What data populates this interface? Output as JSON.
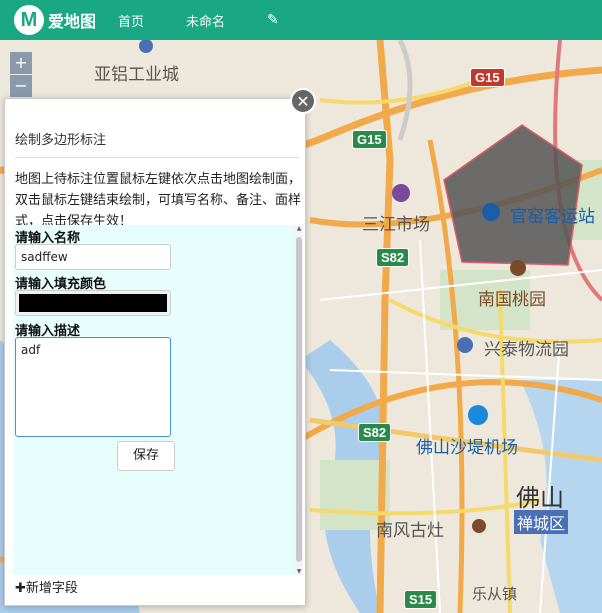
{
  "header": {
    "logo_letter": "M",
    "logo_text": "爱地图",
    "nav": [
      "首页",
      "未命名"
    ],
    "edit_icon": "pencil-icon"
  },
  "map": {
    "zoom_in": "+",
    "zoom_out": "−",
    "labels": {
      "yalv": "亚铝工业城",
      "sanjiang": "三江市场",
      "guanyao": "官窑客运站",
      "nanguo": "南国桃园",
      "xingtai": "兴泰物流园",
      "airport": "佛山沙堤机场",
      "foshan": "佛山",
      "chancheng": "禅城区",
      "nanfeng": "南风古灶",
      "lecong": "乐从镇"
    },
    "shields": {
      "g15_top": "G15",
      "g15_left": "G15",
      "s82_top": "S82",
      "s82_bottom": "S82",
      "s15": "S15"
    },
    "polygon_fill": "#555555",
    "polygon_stroke": "#e05a6a"
  },
  "panel": {
    "title": "绘制多边形标注",
    "description": "地图上待标注位置鼠标左键依次点击地图绘制面，双击鼠标左键结束绘制，可填写名称、备注、面样式，点击保存生效！",
    "name_label": "请输入名称",
    "name_value": "sadffew",
    "color_label": "请输入填充颜色",
    "color_value": "#000000",
    "desc_label": "请输入描述",
    "desc_value": "adf",
    "save_label": "保存",
    "add_field_label": "✚新增字段",
    "close_icon": "close-icon"
  }
}
